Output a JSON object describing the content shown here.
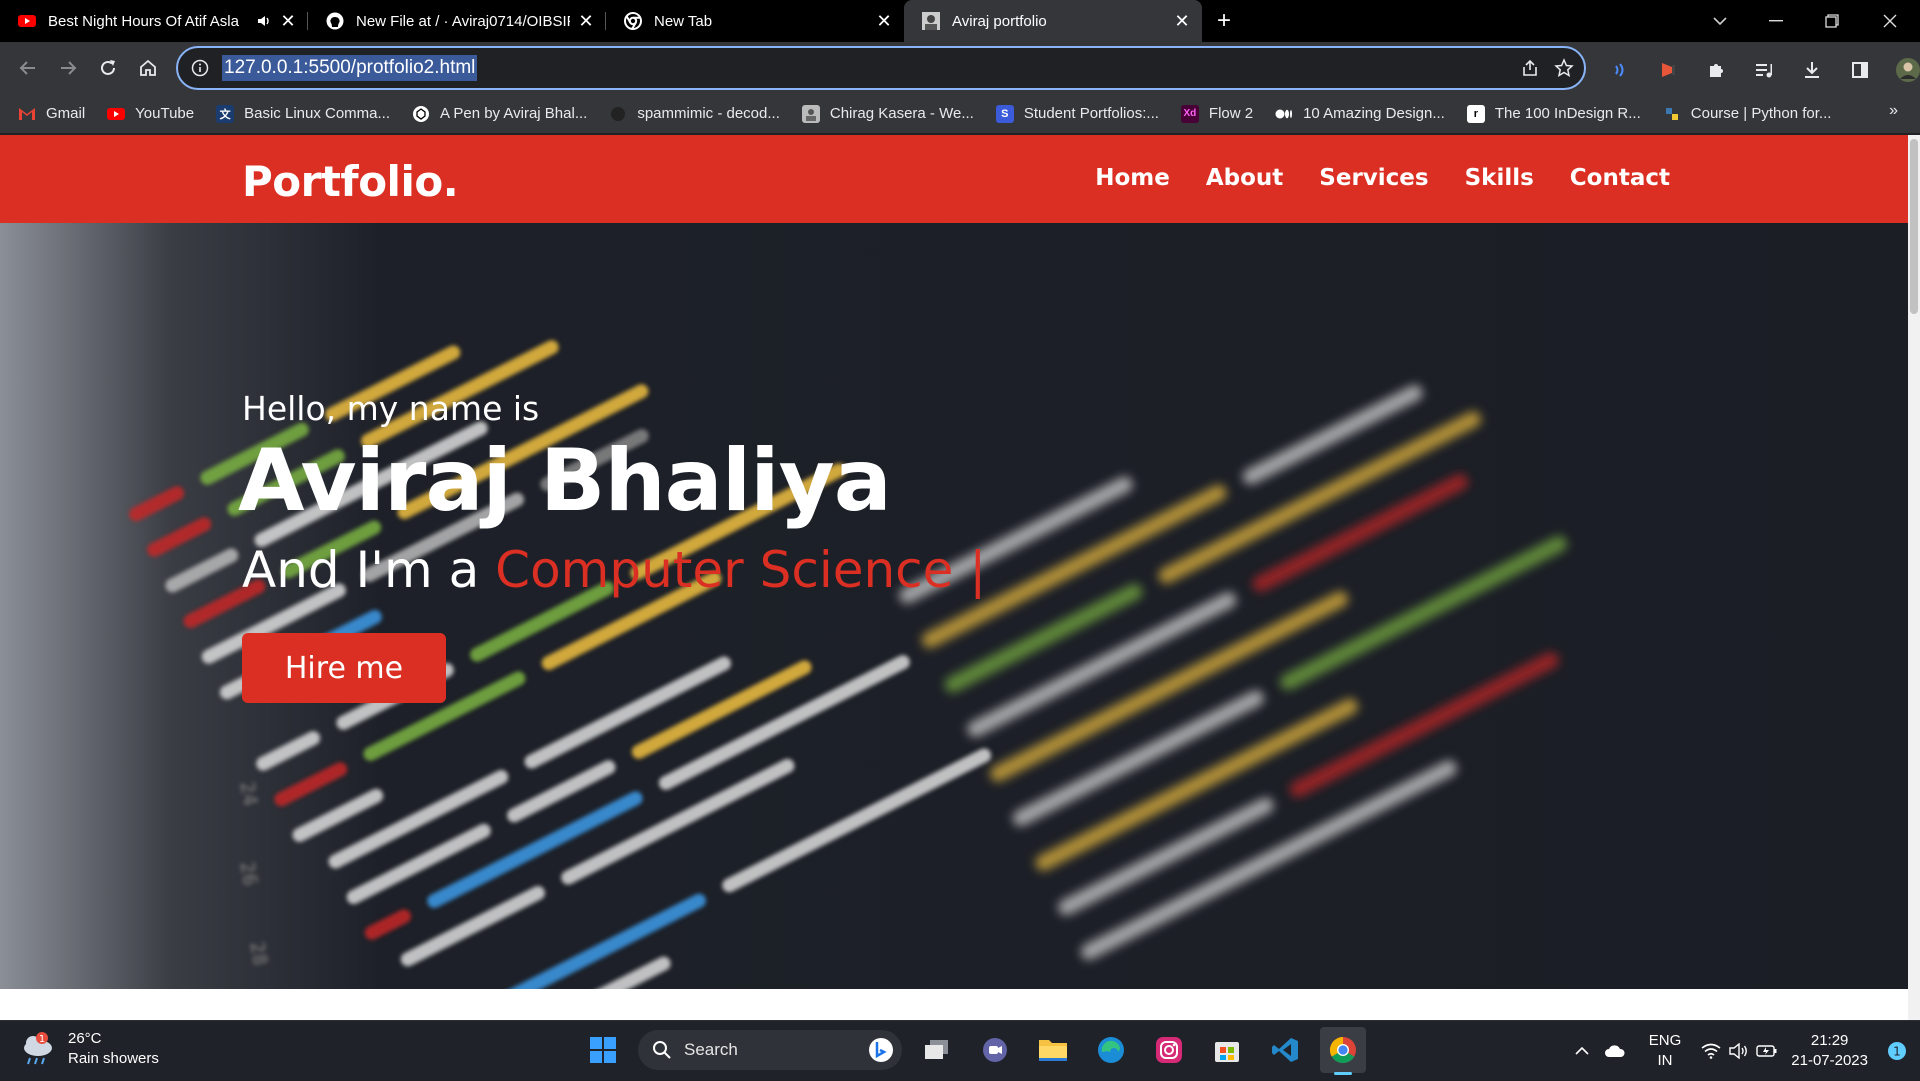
{
  "browser": {
    "tabs": [
      {
        "title": "Best Night Hours Of Atif Asla",
        "active": false,
        "audio": true
      },
      {
        "title": "New File at / · Aviraj0714/OIBSIP",
        "active": false,
        "audio": false
      },
      {
        "title": "New Tab",
        "active": false,
        "audio": false
      },
      {
        "title": "Aviraj portfolio",
        "active": true,
        "audio": false
      }
    ],
    "url": "127.0.0.1:5500/protfolio2.html",
    "bookmarks": [
      {
        "label": "Gmail",
        "icon": "gmail-icon"
      },
      {
        "label": "YouTube",
        "icon": "youtube-icon"
      },
      {
        "label": "Basic Linux Comma...",
        "icon": "translate-icon"
      },
      {
        "label": "A Pen by Aviraj Bhal...",
        "icon": "codepen-icon"
      },
      {
        "label": "spammimic - decod...",
        "icon": "spam-icon"
      },
      {
        "label": "Chirag Kasera - We...",
        "icon": "profile-icon"
      },
      {
        "label": "Student Portfolios:...",
        "icon": "s-icon"
      },
      {
        "label": "Flow 2",
        "icon": "xd-icon"
      },
      {
        "label": "10 Amazing Design...",
        "icon": "medium-icon"
      },
      {
        "label": "The 100 InDesign R...",
        "icon": "r-icon"
      },
      {
        "label": "Course | Python for...",
        "icon": "python-icon"
      }
    ],
    "bookmarks_more": "»"
  },
  "site": {
    "brand": "Portfolio.",
    "nav": [
      "Home",
      "About",
      "Services",
      "Skills",
      "Contact"
    ],
    "hero": {
      "hello": "Hello, my name is",
      "name": "Aviraj Bhaliya",
      "role_prefix": "And I'm a ",
      "role_highlight": "Computer Science |",
      "cta": "Hire me"
    },
    "accent": "#dc2f23"
  },
  "taskbar": {
    "weather_temp": "26°C",
    "weather_desc": "Rain showers",
    "weather_badge": "1",
    "search_placeholder": "Search",
    "lang_top": "ENG",
    "lang_bottom": "IN",
    "time": "21:29",
    "date": "21-07-2023",
    "notif_count": "1"
  }
}
